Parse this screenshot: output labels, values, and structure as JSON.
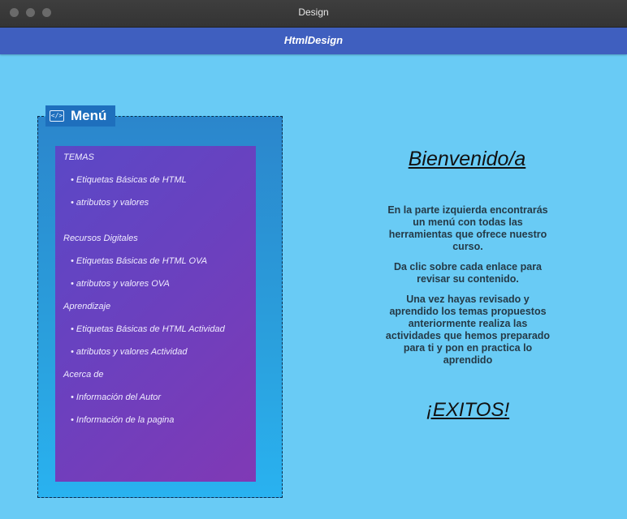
{
  "window": {
    "title": "Design"
  },
  "app": {
    "title": "HtmlDesign"
  },
  "menu": {
    "tab_label": "Menú",
    "tab_icon": "code-icon",
    "sections": [
      {
        "label": "TEMAS",
        "items": [
          "Etiquetas Básicas de HTML",
          "atributos y valores"
        ]
      },
      {
        "label": "Recursos Digitales",
        "items": [
          "Etiquetas Básicas de HTML OVA",
          "atributos y valores OVA"
        ]
      },
      {
        "label": "Aprendizaje",
        "items": [
          "Etiquetas Básicas de HTML  Actividad",
          "atributos y valores  Actividad"
        ]
      },
      {
        "label": "Acerca de",
        "items": [
          "Información del Autor",
          "Información de la pagina"
        ]
      }
    ]
  },
  "welcome": {
    "title": "Bienvenido/a",
    "paragraphs": [
      "En la parte izquierda encontrarás un menú con todas las herramientas que ofrece nuestro curso.",
      "Da clic sobre cada enlace para revisar su contenido.",
      "Una vez hayas revisado y aprendido los temas propuestos anteriormente realiza las actividades que hemos preparado para ti y pon en practica lo aprendido"
    ],
    "closing": "¡EXITOS!"
  },
  "colors": {
    "background": "#69cbf5",
    "app_bar": "#3f5fbf",
    "menu_panel": "#2a9fdc",
    "menu_list_start": "#5b48c6",
    "menu_list_end": "#8039b5"
  }
}
